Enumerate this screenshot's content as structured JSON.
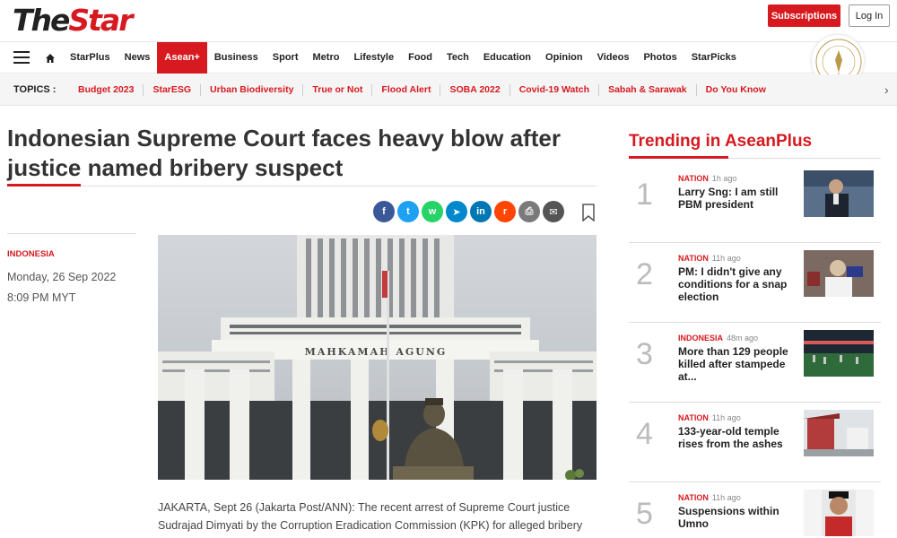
{
  "header": {
    "logo_the": "The",
    "logo_star": "Star",
    "subscribe_label": "Subscriptions",
    "login_label": "Log In"
  },
  "nav": {
    "items": [
      "StarPlus",
      "News",
      "Asean+",
      "Business",
      "Sport",
      "Metro",
      "Lifestyle",
      "Food",
      "Tech",
      "Education",
      "Opinion",
      "Videos",
      "Photos",
      "StarPicks"
    ],
    "active": "Asean+"
  },
  "topics": {
    "label": "TOPICS :",
    "items": [
      "Budget 2023",
      "StarESG",
      "Urban Biodiversity",
      "True or Not",
      "Flood Alert",
      "SOBA 2022",
      "Covid-19 Watch",
      "Sabah & Sarawak",
      "Do You Know"
    ]
  },
  "article": {
    "headline": "Indonesian Supreme Court faces heavy blow after justice named bribery suspect",
    "category": "INDONESIA",
    "date": "Monday, 26 Sep 2022",
    "time": "8:09 PM MYT",
    "photo_sign_text": "MAHKAMAH AGUNG",
    "body": "JAKARTA, Sept 26 (Jakarta Post/ANN): The recent arrest of Supreme Court justice Sudrajad Dimyati by the Corruption Eradication Commission (KPK) for alleged bribery"
  },
  "share_buttons": [
    {
      "name": "facebook",
      "glyph": "f",
      "color": "#3b5998"
    },
    {
      "name": "twitter",
      "glyph": "t",
      "color": "#1da1f2"
    },
    {
      "name": "whatsapp",
      "glyph": "w",
      "color": "#25d366"
    },
    {
      "name": "telegram",
      "glyph": "➤",
      "color": "#0088cc"
    },
    {
      "name": "linkedin",
      "glyph": "in",
      "color": "#0077b5"
    },
    {
      "name": "reddit",
      "glyph": "r",
      "color": "#ff4500"
    },
    {
      "name": "print",
      "glyph": "⎙",
      "color": "#7a7a7a"
    },
    {
      "name": "email",
      "glyph": "✉",
      "color": "#555555"
    }
  ],
  "trending": {
    "title": "Trending in AseanPlus",
    "items": [
      {
        "num": "1",
        "category": "NATION",
        "age": "1h ago",
        "title": "Larry Sng: I am still PBM president"
      },
      {
        "num": "2",
        "category": "NATION",
        "age": "11h ago",
        "title": "PM: I didn't give any conditions for a snap election"
      },
      {
        "num": "3",
        "category": "INDONESIA",
        "age": "48m ago",
        "title": "More than 129 people killed after stampede at..."
      },
      {
        "num": "4",
        "category": "NATION",
        "age": "11h ago",
        "title": "133-year-old temple rises from the ashes"
      },
      {
        "num": "5",
        "category": "NATION",
        "age": "11h ago",
        "title": "Suspensions within Umno"
      }
    ]
  },
  "colors": {
    "brand_red": "#d71920"
  }
}
